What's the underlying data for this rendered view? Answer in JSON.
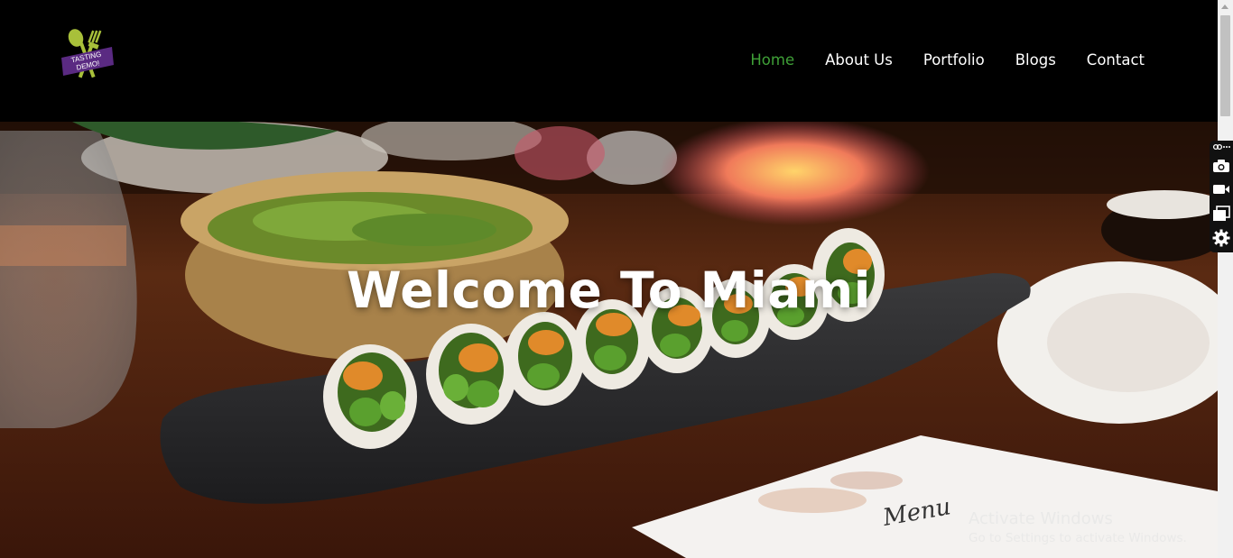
{
  "header": {
    "logo_text_line1": "TASTING",
    "logo_text_line2": "DEMO!",
    "nav": [
      {
        "label": "Home",
        "active": true
      },
      {
        "label": "About Us",
        "active": false
      },
      {
        "label": "Portfolio",
        "active": false
      },
      {
        "label": "Blogs",
        "active": false
      },
      {
        "label": "Contact",
        "active": false
      }
    ]
  },
  "hero": {
    "title": "Welcome To Miami",
    "menu_card_text": "Menu"
  },
  "watermark": {
    "title": "Activate Windows",
    "subtitle": "Go to Settings to activate Windows."
  },
  "side_toolbar": {
    "icons": [
      "link-icon",
      "camera-icon",
      "video-icon",
      "window-icon",
      "settings-icon"
    ]
  },
  "colors": {
    "active_nav": "#3fa037",
    "header_bg": "#000000",
    "logo_purple": "#5a2a82",
    "logo_green": "#a8c03a"
  }
}
